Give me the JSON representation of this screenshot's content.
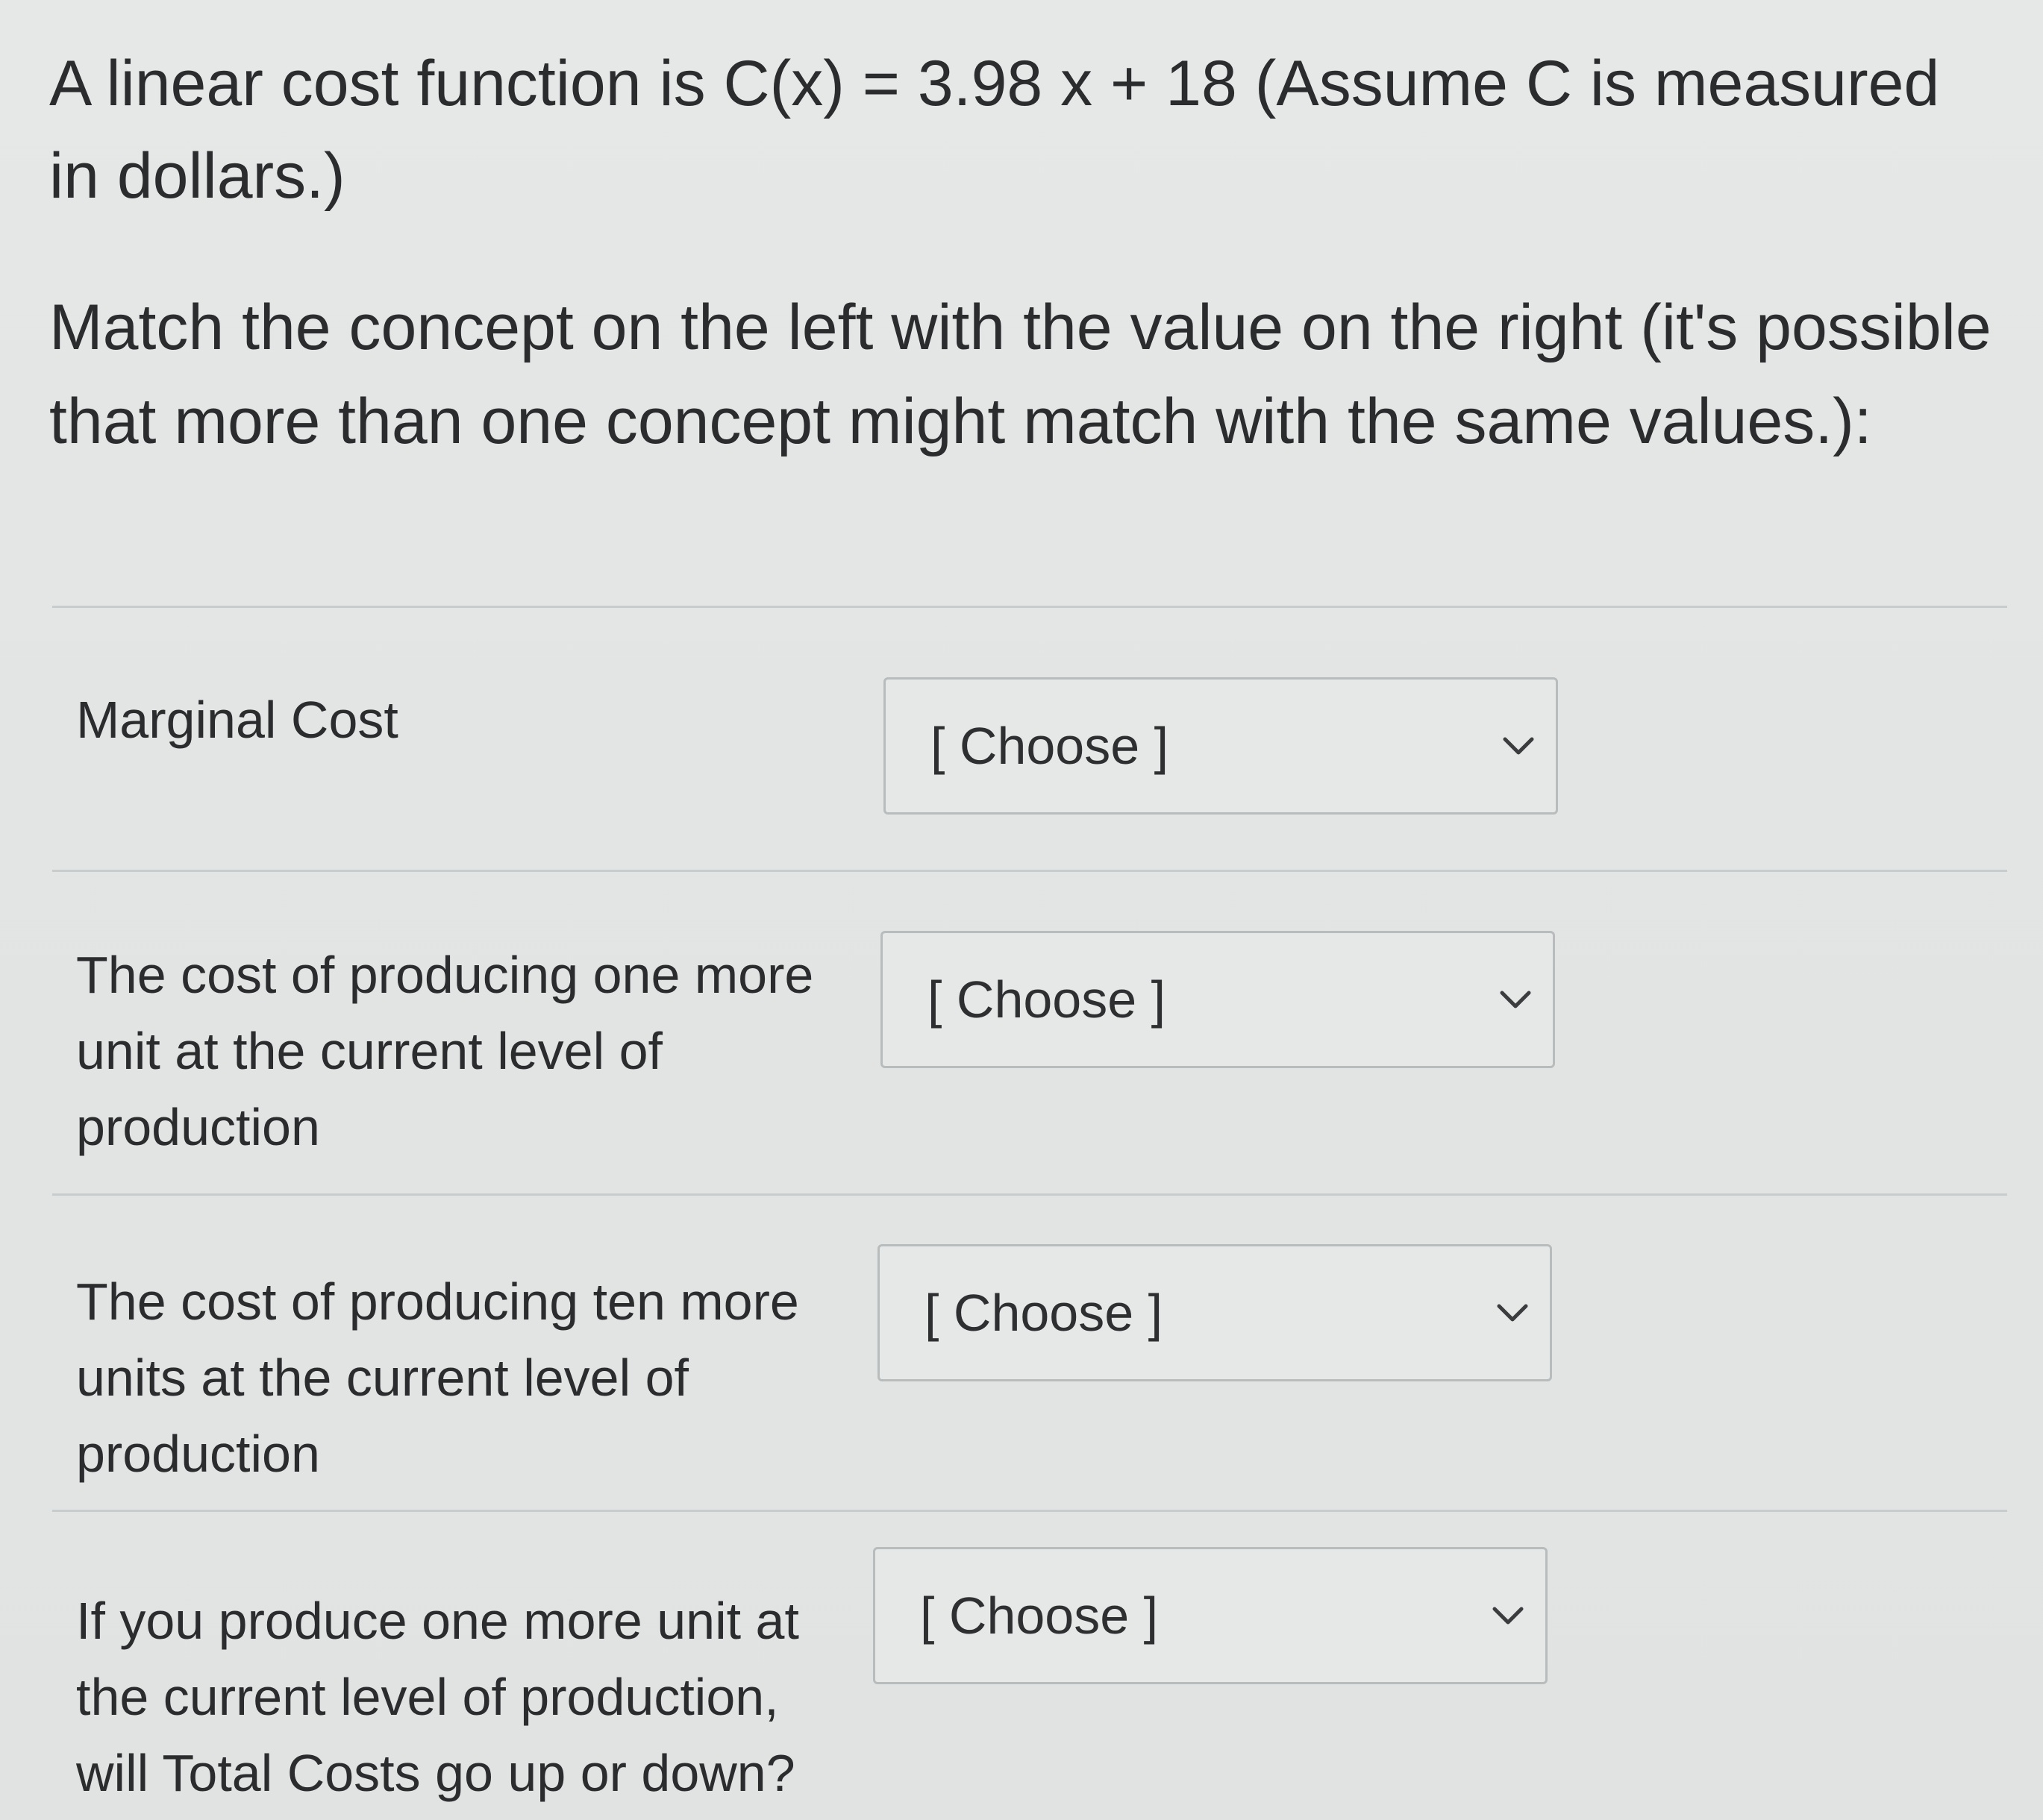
{
  "question": {
    "intro": "A linear cost function is C(x) = 3.98 x + 18 (Assume C is measured in dollars.)",
    "instructions": "Match the concept on the left with the value on the right (it's possible that more than one concept might match with the same values.):"
  },
  "rows": [
    {
      "concept": "Marginal Cost",
      "select_value": "[ Choose ]"
    },
    {
      "concept": "The cost of producing one more unit at the current level of production",
      "select_value": "[ Choose ]"
    },
    {
      "concept": "The cost of producing ten more units at the current level of production",
      "select_value": "[ Choose ]"
    },
    {
      "concept": "If you produce one more unit at the current level of production, will Total Costs go up or down?",
      "select_value": "[ Choose ]"
    }
  ],
  "icons": {
    "dropdown": "chevron-down-icon"
  }
}
